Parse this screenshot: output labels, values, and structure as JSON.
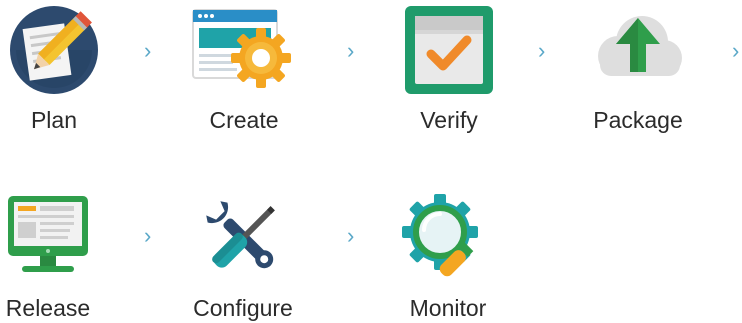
{
  "stages": [
    {
      "label": "Plan",
      "icon": "plan-pencil-document-icon"
    },
    {
      "label": "Create",
      "icon": "create-window-gear-icon"
    },
    {
      "label": "Verify",
      "icon": "verify-checkmark-icon"
    },
    {
      "label": "Package",
      "icon": "package-cloud-upload-icon"
    },
    {
      "label": "Release",
      "icon": "release-monitor-icon"
    },
    {
      "label": "Configure",
      "icon": "configure-tools-icon"
    },
    {
      "label": "Monitor",
      "icon": "monitor-magnifier-gear-icon"
    }
  ],
  "connector": {
    "glyph": "›",
    "color": "#5aa8c8"
  },
  "colors": {
    "navy": "#2d4a6e",
    "teal": "#1fa3a8",
    "green": "#2f9e4b",
    "orange": "#f4a621",
    "red": "#e0553a",
    "gray": "#dcdcdc"
  }
}
